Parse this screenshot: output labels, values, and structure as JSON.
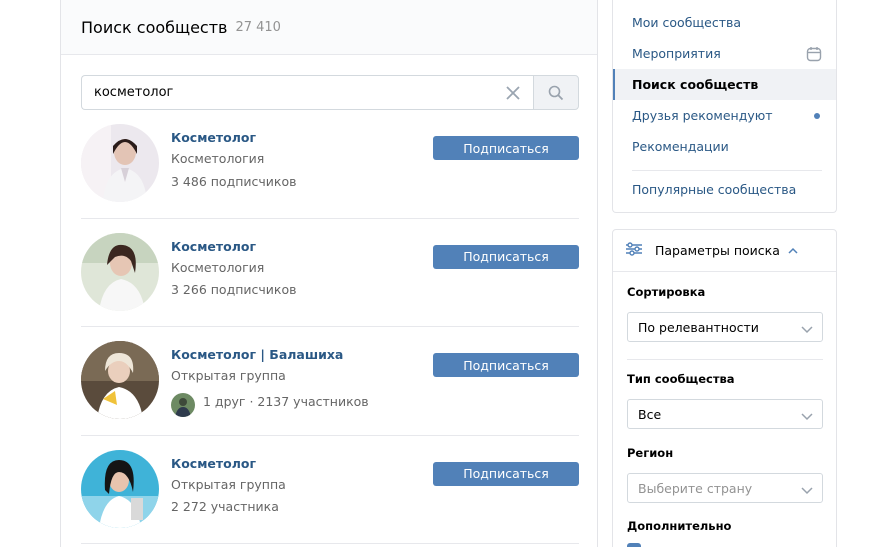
{
  "header": {
    "title": "Поиск сообществ",
    "count": "27 410"
  },
  "search": {
    "value": "косметолог",
    "placeholder": ""
  },
  "results": [
    {
      "name": "Косметолог",
      "type": "Косметология",
      "members": "3 486 подписчиков",
      "button": "Подписаться",
      "has_friend": false
    },
    {
      "name": "Косметолог",
      "type": "Косметология",
      "members": "3 266 подписчиков",
      "button": "Подписаться",
      "has_friend": false
    },
    {
      "name": "Косметолог | Балашиха",
      "type": "Открытая группа",
      "members": "1 друг · 2137 участников",
      "button": "Подписаться",
      "has_friend": true
    },
    {
      "name": "Косметолог",
      "type": "Открытая группа",
      "members": "2 272 участника",
      "button": "Подписаться",
      "has_friend": false
    }
  ],
  "menu": {
    "items": [
      {
        "label": "Мои сообщества",
        "active": false,
        "icon": ""
      },
      {
        "label": "Мероприятия",
        "active": false,
        "icon": "calendar-icon"
      },
      {
        "label": "Поиск сообществ",
        "active": true,
        "icon": ""
      },
      {
        "label": "Друзья рекомендуют",
        "active": false,
        "icon": "dot-badge"
      },
      {
        "label": "Рекомендации",
        "active": false,
        "icon": ""
      },
      {
        "label": "Популярные сообщества",
        "active": false,
        "icon": ""
      }
    ]
  },
  "params": {
    "title": "Параметры поиска",
    "sort_label": "Сортировка",
    "sort_value": "По релевантности",
    "type_label": "Тип сообщества",
    "type_value": "Все",
    "region_label": "Регион",
    "region_placeholder": "Выберите страну",
    "extra_label": "Дополнительно"
  },
  "colors": {
    "accent": "#5181b8",
    "link": "#2a5885",
    "muted": "#656565",
    "border": "#e7e8ec"
  }
}
